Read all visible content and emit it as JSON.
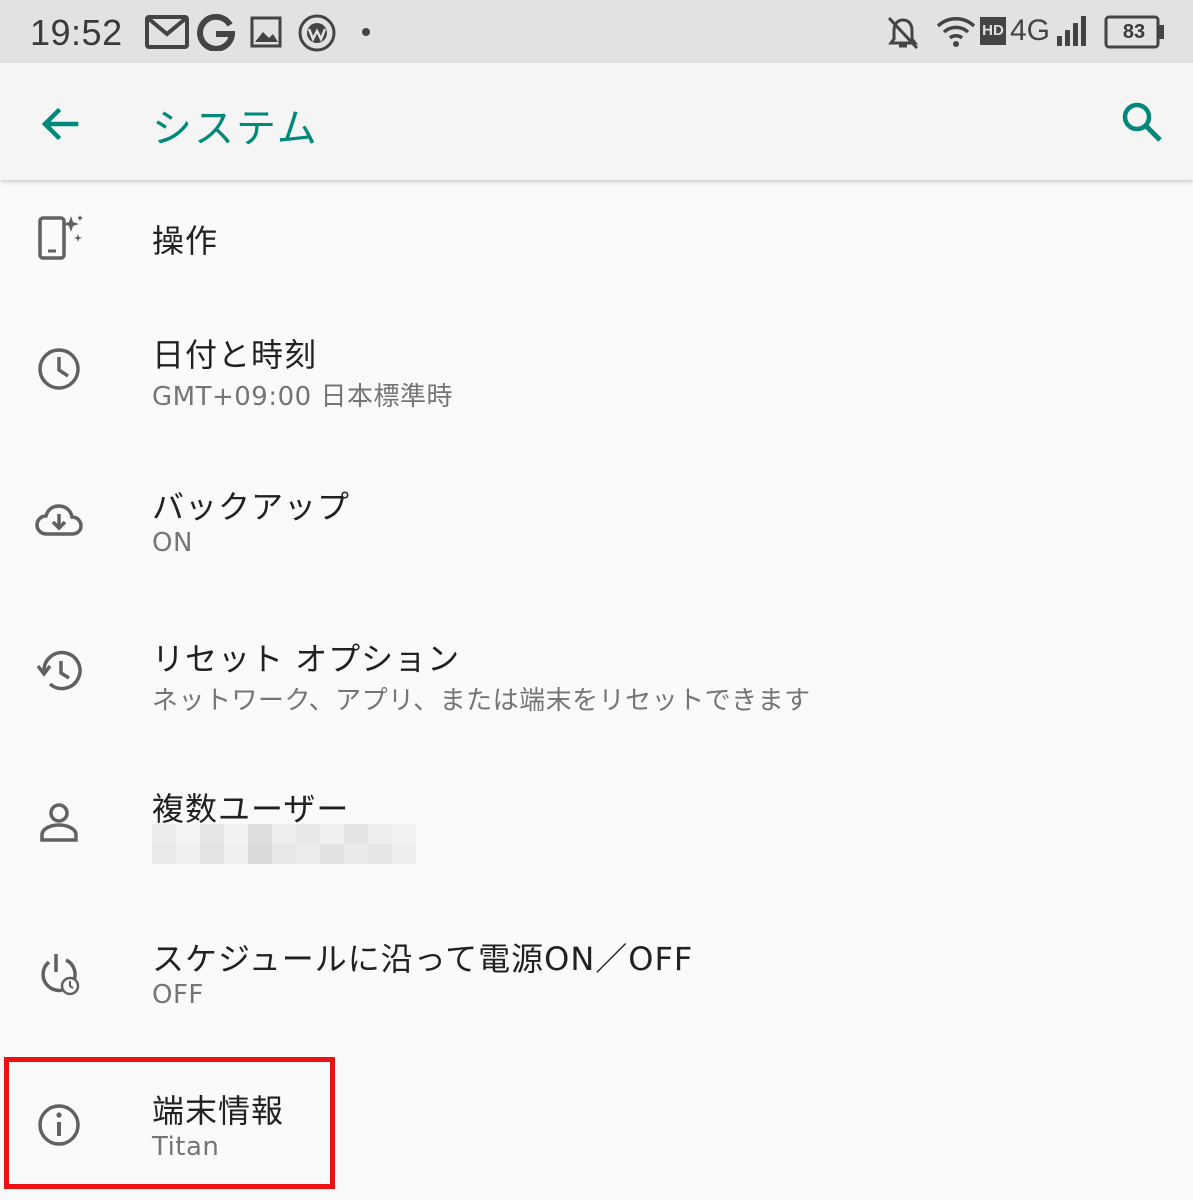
{
  "status_bar": {
    "time": "19:52",
    "network": "4G",
    "hd": "HD",
    "battery": "83"
  },
  "app_bar": {
    "title": "システム",
    "back_icon": "arrow-back-icon",
    "search_icon": "search-icon"
  },
  "items": [
    {
      "title": "操作",
      "subtitle": "",
      "icon": "gestures-icon"
    },
    {
      "title": "日付と時刻",
      "subtitle": "GMT+09:00 日本標準時",
      "icon": "clock-icon"
    },
    {
      "title": "バックアップ",
      "subtitle": "ON",
      "icon": "cloud-backup-icon"
    },
    {
      "title": "リセット オプション",
      "subtitle": "ネットワーク、アプリ、または端末をリセットできます",
      "icon": "history-icon"
    },
    {
      "title": "複数ユーザー",
      "subtitle": "",
      "icon": "person-icon"
    },
    {
      "title": "スケジュールに沿って電源ON／OFF",
      "subtitle": "OFF",
      "icon": "scheduled-power-icon"
    },
    {
      "title": "端末情報",
      "subtitle": "Titan",
      "icon": "info-icon"
    }
  ],
  "colors": {
    "accent": "#00897b",
    "highlight": "#ee1111",
    "title_text": "#212121",
    "subtitle_text": "#757575"
  }
}
